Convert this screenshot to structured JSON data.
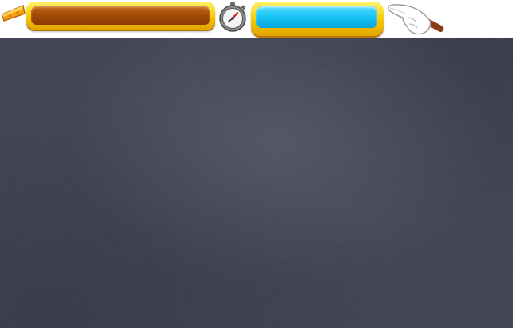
{
  "hud": {
    "cheese_meter": {
      "icon": "cheese-icon",
      "level_fraction": 1.0,
      "fill_color": "#a04a08",
      "frame_color": "#f5c800"
    },
    "timer": {
      "icon": "stopwatch-icon",
      "level_fraction": 1.0,
      "fill_color": "#16c3f2",
      "frame_color": "#f5c800"
    },
    "hint_button": {
      "icon": "pointing-hand-icon"
    }
  },
  "board": {
    "background_color": "#373c4c"
  }
}
